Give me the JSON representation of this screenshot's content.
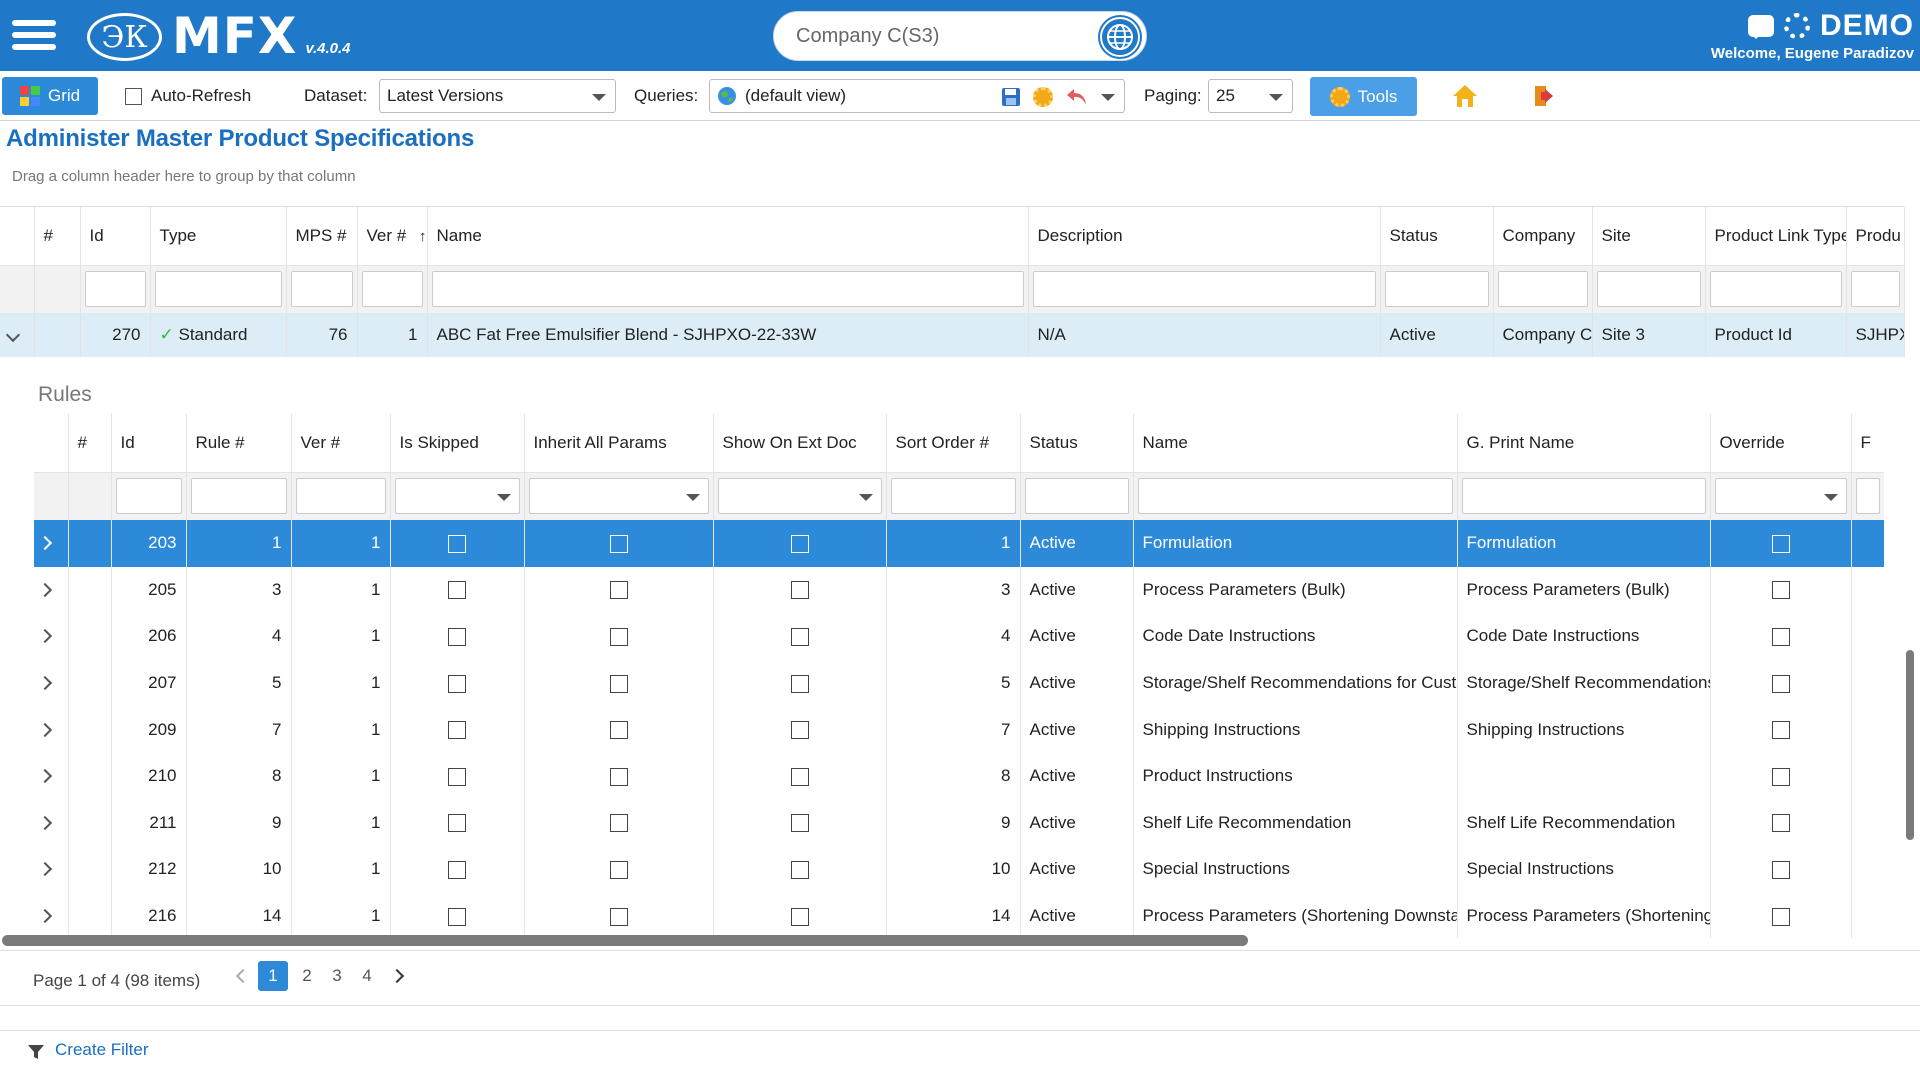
{
  "app": {
    "logo_mark": "ЭК",
    "name": "MFX",
    "version": "v.4.0.4",
    "company_search": "Company C(S3)",
    "env": "DEMO",
    "welcome": "Welcome, Eugene Paradizov"
  },
  "toolbar": {
    "grid_label": "Grid",
    "auto_refresh_label": "Auto-Refresh",
    "dataset_label": "Dataset:",
    "dataset_value": "Latest Versions",
    "queries_label": "Queries:",
    "queries_value": "(default view)",
    "paging_label": "Paging:",
    "paging_value": "25",
    "tools_label": "Tools"
  },
  "page": {
    "title": "Administer Master Product Specifications",
    "group_hint": "Drag a column header here to group by that column"
  },
  "master_grid": {
    "columns": [
      "#",
      "Id",
      "Type",
      "MPS #",
      "Ver #",
      "Name",
      "Description",
      "Status",
      "Company",
      "Site",
      "Product Link Type",
      "Produ"
    ],
    "row": {
      "id": "270",
      "type": "Standard",
      "mps": "76",
      "ver": "1",
      "name": "ABC Fat Free Emulsifier Blend - SJHPXO-22-33W",
      "description": "N/A",
      "status": "Active",
      "company": "Company C",
      "site": "Site 3",
      "product_link_type": "Product Id",
      "produ": "SJHPX"
    }
  },
  "rules": {
    "label": "Rules",
    "columns": [
      "#",
      "Id",
      "Rule #",
      "Ver #",
      "Is Skipped",
      "Inherit All Params",
      "Show On Ext Doc",
      "Sort Order #",
      "Status",
      "Name",
      "G. Print Name",
      "Override",
      "F"
    ],
    "rows": [
      {
        "id": "203",
        "rule": "1",
        "ver": "1",
        "sort": "1",
        "status": "Active",
        "name": "Formulation",
        "gprint": "Formulation"
      },
      {
        "id": "205",
        "rule": "3",
        "ver": "1",
        "sort": "3",
        "status": "Active",
        "name": "Process Parameters (Bulk)",
        "gprint": "Process Parameters (Bulk)"
      },
      {
        "id": "206",
        "rule": "4",
        "ver": "1",
        "sort": "4",
        "status": "Active",
        "name": "Code Date Instructions",
        "gprint": "Code Date Instructions"
      },
      {
        "id": "207",
        "rule": "5",
        "ver": "1",
        "sort": "5",
        "status": "Active",
        "name": "Storage/Shelf Recommendations for Custo",
        "gprint": "Storage/Shelf Recommendations"
      },
      {
        "id": "209",
        "rule": "7",
        "ver": "1",
        "sort": "7",
        "status": "Active",
        "name": "Shipping Instructions",
        "gprint": "Shipping Instructions"
      },
      {
        "id": "210",
        "rule": "8",
        "ver": "1",
        "sort": "8",
        "status": "Active",
        "name": "Product Instructions",
        "gprint": ""
      },
      {
        "id": "211",
        "rule": "9",
        "ver": "1",
        "sort": "9",
        "status": "Active",
        "name": "Shelf Life Recommendation",
        "gprint": "Shelf Life Recommendation"
      },
      {
        "id": "212",
        "rule": "10",
        "ver": "1",
        "sort": "10",
        "status": "Active",
        "name": "Special Instructions",
        "gprint": "Special Instructions"
      },
      {
        "id": "216",
        "rule": "14",
        "ver": "1",
        "sort": "14",
        "status": "Active",
        "name": "Process Parameters (Shortening Downstai",
        "gprint": "Process Parameters (Shortening"
      }
    ]
  },
  "pager": {
    "info": "Page 1 of 4 (98 items)",
    "pages": [
      "1",
      "2",
      "3",
      "4"
    ]
  },
  "footer": {
    "create_filter": "Create Filter"
  },
  "colors": {
    "header_blue": "#1f78c8",
    "selected_row": "#2c8ad8",
    "master_row": "#dcedf7",
    "title_blue": "#1a6fc0"
  }
}
